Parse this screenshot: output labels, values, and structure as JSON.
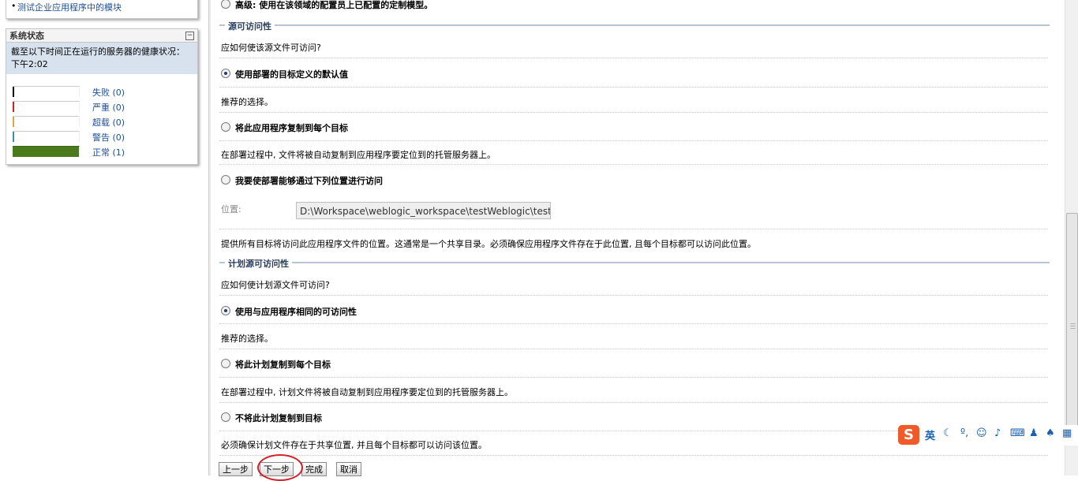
{
  "left": {
    "top_link": "测试企业应用程序中的模块",
    "status_panel": {
      "title": "系统状态",
      "description": "截至以下时间正在运行的服务器的健康状况：下午2:02",
      "items": [
        {
          "label": "失败 (0)",
          "color": "#000000"
        },
        {
          "label": "严重 (0)",
          "color": "#cc2222"
        },
        {
          "label": "超载 (0)",
          "color": "#d9a640"
        },
        {
          "label": "警告 (0)",
          "color": "#3a8fb0"
        },
        {
          "label": "正常 (1)",
          "color": "#4a7a1c"
        }
      ]
    }
  },
  "main": {
    "top_option": "高级: 使用在该领域的配置员上已配置的定制模型。",
    "source": {
      "title": "源可访问性",
      "question": "应如何使该源文件可访问?",
      "options": [
        {
          "label": "使用部署的目标定义的默认值",
          "selected": true,
          "desc": "推荐的选择。"
        },
        {
          "label": "将此应用程序复制到每个目标",
          "selected": false,
          "desc": "在部署过程中, 文件将被自动复制到应用程序要定位到的托管服务器上。"
        },
        {
          "label": "我要使部署能够通过下列位置进行访问",
          "selected": false,
          "desc": "提供所有目标将访问此应用程序文件的位置。这通常是一个共享目录。必须确保应用程序文件存在于此位置, 且每个目标都可以访问此位置。"
        }
      ],
      "location_label": "位置:",
      "location_value": "D:\\Workspace\\weblogic_workspace\\testWeblogic\\testW"
    },
    "plan": {
      "title": "计划源可访问性",
      "question": "应如何使计划源文件可访问?",
      "options": [
        {
          "label": "使用与应用程序相同的可访问性",
          "selected": true,
          "desc": "推荐的选择。"
        },
        {
          "label": "将此计划复制到每个目标",
          "selected": false,
          "desc": "在部署过程中, 计划文件将被自动复制到应用程序要定位到的托管服务器上。"
        },
        {
          "label": "不将此计划复制到目标",
          "selected": false,
          "desc": "必须确保计划文件存在于共享位置, 并且每个目标都可以访问该位置。"
        }
      ]
    },
    "buttons": {
      "back": "上一步",
      "next": "下一步",
      "finish": "完成",
      "cancel": "取消"
    }
  },
  "ime": {
    "logo": "S",
    "mode": "英"
  }
}
